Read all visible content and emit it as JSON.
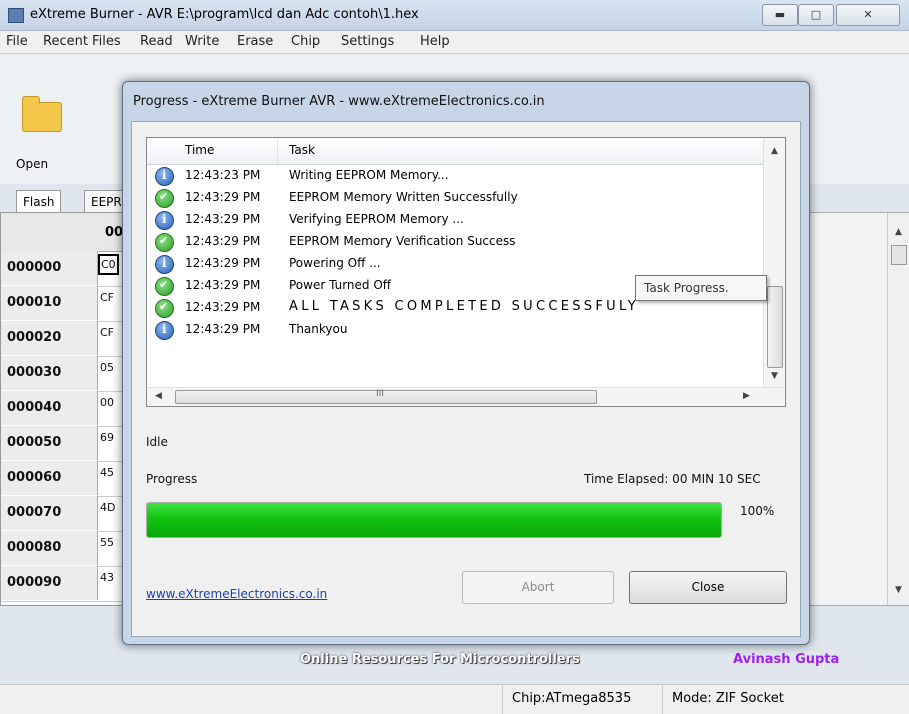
{
  "window": {
    "title": "eXtreme Burner - AVR E:\\program\\lcd dan Adc contoh\\1.hex"
  },
  "menu": [
    "File",
    "Recent Files",
    "Read",
    "Write",
    "Erase",
    "Chip",
    "Settings",
    "Help"
  ],
  "toolbar": {
    "open_label": "Open"
  },
  "tabs": [
    "Flash",
    "EEPR"
  ],
  "grid": {
    "column_header": "00",
    "rows": [
      {
        "address": "000000",
        "value": "C0"
      },
      {
        "address": "000010",
        "value": "CF"
      },
      {
        "address": "000020",
        "value": "CF"
      },
      {
        "address": "000030",
        "value": "05"
      },
      {
        "address": "000040",
        "value": "00"
      },
      {
        "address": "000050",
        "value": "69"
      },
      {
        "address": "000060",
        "value": "45"
      },
      {
        "address": "000070",
        "value": "4D"
      },
      {
        "address": "000080",
        "value": "55"
      },
      {
        "address": "000090",
        "value": "43"
      }
    ]
  },
  "dialog": {
    "title": "Progress - eXtreme Burner AVR - www.eXtremeElectronics.co.in",
    "columns": {
      "time": "Time",
      "task": "Task"
    },
    "log": [
      {
        "icon": "info-icon",
        "time": "12:43:23 PM",
        "task": "Writing EEPROM Memory..."
      },
      {
        "icon": "success-icon",
        "time": "12:43:29 PM",
        "task": "EEPROM Memory Written Successfully"
      },
      {
        "icon": "info-icon",
        "time": "12:43:29 PM",
        "task": "Verifying EEPROM Memory ..."
      },
      {
        "icon": "success-icon",
        "time": "12:43:29 PM",
        "task": "EEPROM Memory Verification Success"
      },
      {
        "icon": "info-icon",
        "time": "12:43:29 PM",
        "task": "Powering Off ..."
      },
      {
        "icon": "success-icon",
        "time": "12:43:29 PM",
        "task": "Power Turned Off"
      },
      {
        "icon": "success-icon",
        "time": "12:43:29 PM",
        "task": "ALL TASKS COMPLETED SUCCESSFULY"
      },
      {
        "icon": "info-icon",
        "time": "12:43:29 PM",
        "task": "Thankyou"
      }
    ],
    "tooltip": "Task Progress.",
    "hscroll_grip": "III",
    "status": "Idle",
    "progress_label": "Progress",
    "time_elapsed": "Time Elapsed: 00 MIN  10 SEC",
    "progress_percent": "100%",
    "progress_value": 100,
    "link": "www.eXtremeElectronics.co.in",
    "abort_label": "Abort",
    "close_label": "Close"
  },
  "banner": {
    "text": "Online Resources For Microcontrollers",
    "author": "Avinash Gupta"
  },
  "statusbar": {
    "chip": "Chip:ATmega8535",
    "mode": "Mode: ZIF Socket"
  },
  "colors": {
    "progress_fill": "#11c511",
    "link": "#1a3fb0",
    "author": "#a020f0"
  }
}
